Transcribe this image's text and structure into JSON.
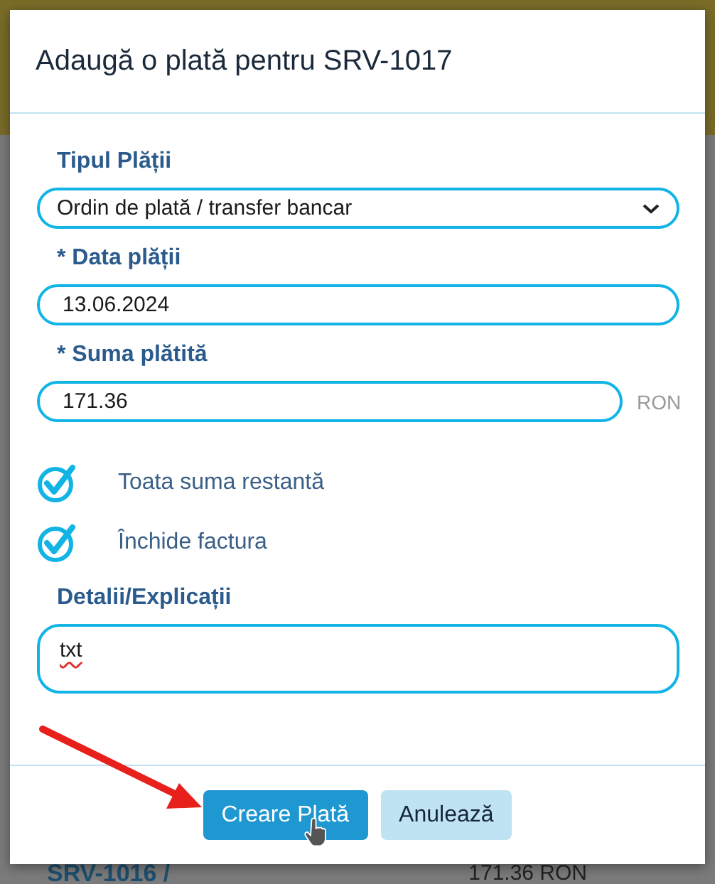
{
  "background": {
    "row": {
      "invoice": "SRV-1016 /",
      "amount": "171.36 RON"
    }
  },
  "dialog": {
    "title": "Adaugă o plată pentru SRV-1017",
    "fields": [
      {
        "kind": "select",
        "label": "Tipul Plății",
        "value": "Ordin de plată / transfer bancar"
      },
      {
        "kind": "text",
        "label": "Data plății",
        "marker": "*",
        "value": "13.06.2024"
      },
      {
        "kind": "text",
        "label": "Suma plătită",
        "marker": "*",
        "value": "171.36",
        "suffix": "RON"
      }
    ],
    "checks": [
      {
        "label": "Toata suma restantă",
        "checked": true
      },
      {
        "label": "Închide factura",
        "checked": true
      }
    ],
    "details": {
      "label": "Detalii/Explicații",
      "value": "txt"
    },
    "buttons": [
      {
        "label": "Creare Plată",
        "kind": "primary"
      },
      {
        "label": "Anulează",
        "kind": "secondary"
      }
    ]
  }
}
